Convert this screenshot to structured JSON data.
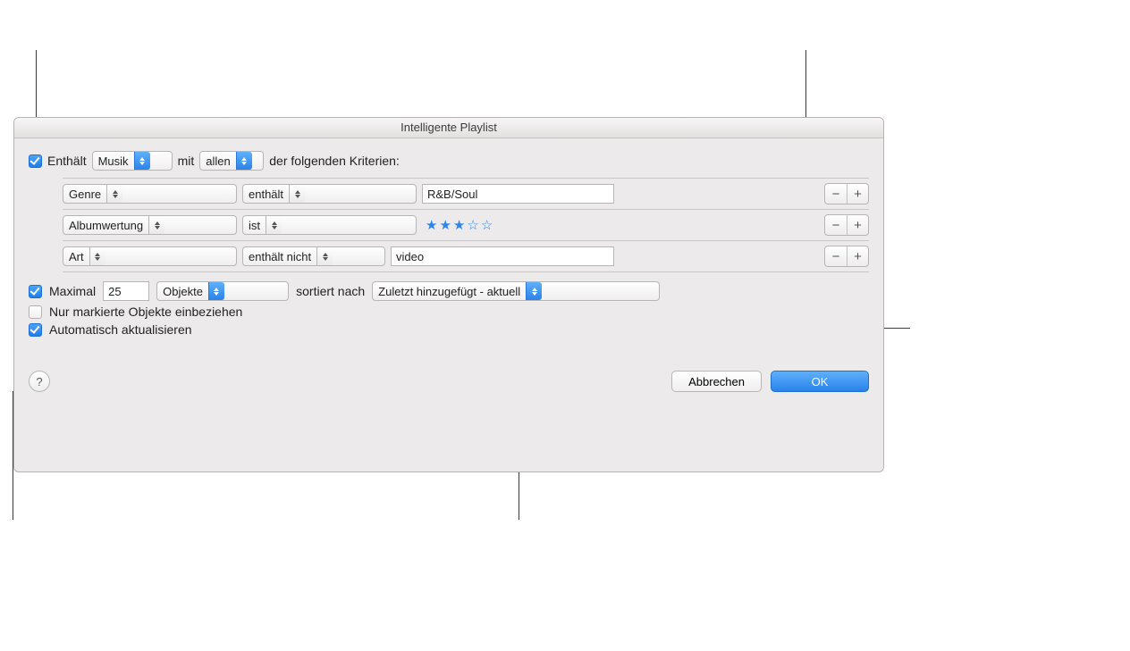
{
  "dialog": {
    "title": "Intelligente Playlist",
    "match": {
      "contains_label": "Enthält",
      "media_type": "Musik",
      "middle_label": "mit",
      "match_mode": "allen",
      "suffix_label": "der folgenden Kriterien:"
    },
    "rules": [
      {
        "criterion": "Genre",
        "operator": "enthält",
        "value": "R&B/Soul",
        "kind": "text"
      },
      {
        "criterion": "Albumwertung",
        "operator": "ist",
        "rating": 3,
        "kind": "stars"
      },
      {
        "criterion": "Art",
        "operator": "enthält nicht",
        "value": "video",
        "kind": "text"
      }
    ],
    "limit": {
      "label": "Maximal",
      "count": "25",
      "unit": "Objekte",
      "sort_label": "sortiert nach",
      "sort_by": "Zuletzt hinzugefügt - aktuell"
    },
    "only_checked_label": "Nur markierte Objekte einbeziehen",
    "live_update_label": "Automatisch aktualisieren",
    "buttons": {
      "cancel": "Abbrechen",
      "ok": "OK"
    },
    "icons": {
      "minus": "−",
      "plus": "+",
      "help": "?"
    }
  }
}
